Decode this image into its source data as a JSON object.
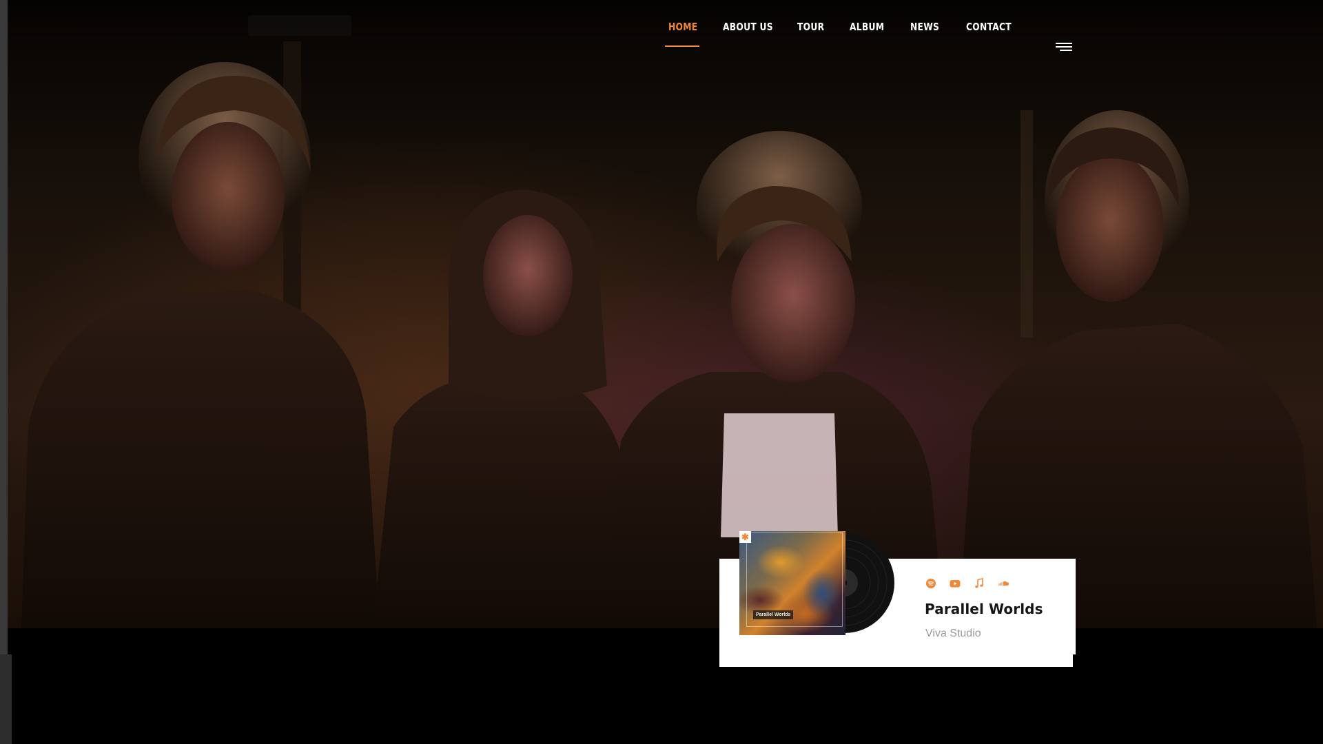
{
  "nav": {
    "items": [
      {
        "label": "HOME",
        "active": true
      },
      {
        "label": "ABOUT US",
        "active": false
      },
      {
        "label": "TOUR",
        "active": false
      },
      {
        "label": "ALBUM",
        "active": false
      },
      {
        "label": "NEWS",
        "active": false
      },
      {
        "label": "CONTACT",
        "active": false
      }
    ],
    "menu_icon": "hamburger-menu-icon"
  },
  "hero": {
    "image": "band-photo-four-members-night"
  },
  "album_card": {
    "title": "Parallel Worlds",
    "subtitle": "Viva Studio",
    "cover_text": "Parallel Worlds",
    "cover_badge_icon": "asterisk-icon",
    "platforms": [
      {
        "icon": "spotify-icon"
      },
      {
        "icon": "youtube-icon"
      },
      {
        "icon": "music-note-icon"
      },
      {
        "icon": "soundcloud-icon"
      }
    ]
  },
  "colors": {
    "accent": "#f0883a",
    "background": "#000000",
    "card": "#ffffff",
    "title": "#161616",
    "subtitle": "#9a9a9a"
  }
}
